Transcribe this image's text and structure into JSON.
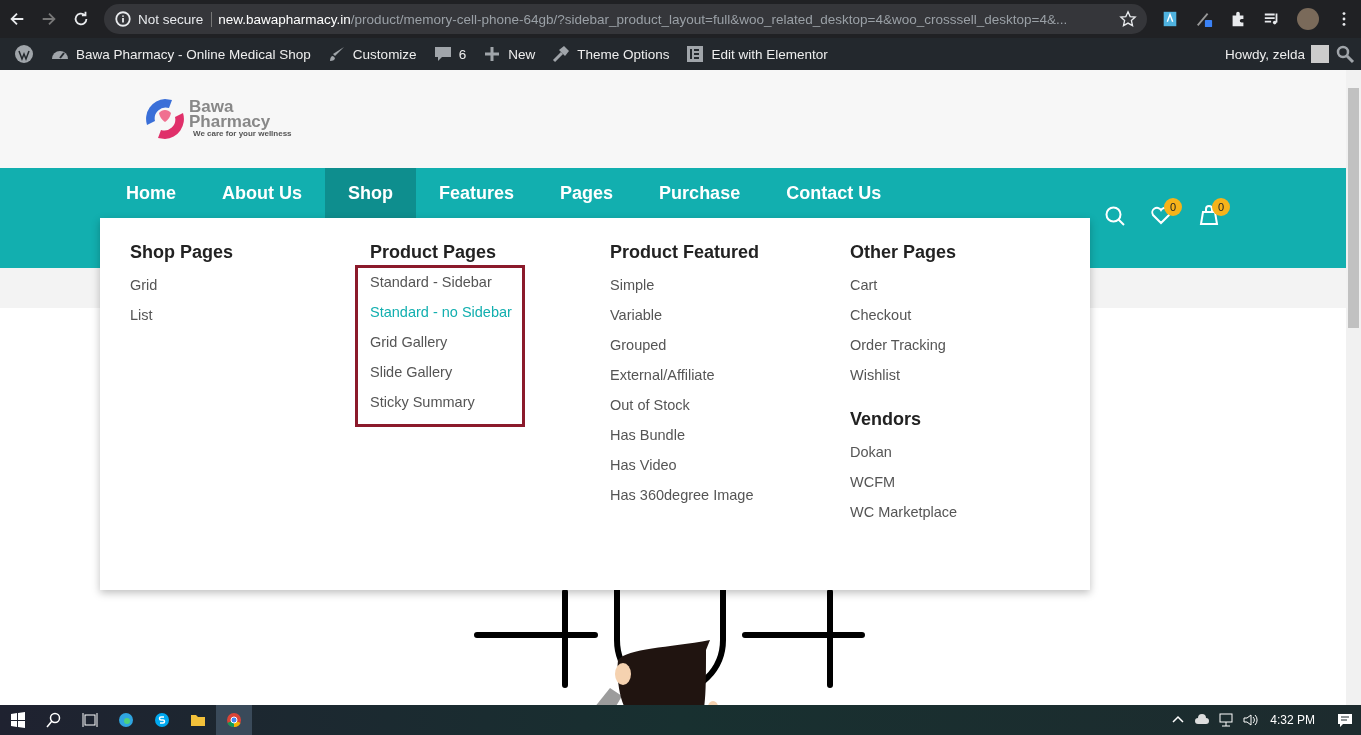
{
  "browser": {
    "security_label": "Not secure",
    "url_host": "new.bawapharmacy.in",
    "url_path": "/product/memory-cell-phone-64gb/?sidebar_product_layout=full&woo_related_desktop=4&woo_crosssell_desktop=4&..."
  },
  "admin_bar": {
    "items": [
      {
        "kind": "wordpress"
      },
      {
        "kind": "dashboard",
        "label": "Bawa Pharmacy - Online Medical Shop"
      },
      {
        "kind": "brush",
        "label": "Customize"
      },
      {
        "kind": "comment",
        "label": "6"
      },
      {
        "kind": "plus",
        "label": "New"
      },
      {
        "kind": "hammer",
        "label": "Theme Options"
      },
      {
        "kind": "elementor",
        "label": "Edit with Elementor"
      }
    ],
    "greeting": "Howdy, zelda"
  },
  "logo": {
    "line1": "Bawa",
    "line2": "Pharmacy",
    "tagline": "We care for your wellness"
  },
  "nav": [
    {
      "label": "Home",
      "selected": false
    },
    {
      "label": "About Us",
      "selected": false
    },
    {
      "label": "Shop",
      "selected": true
    },
    {
      "label": "Features",
      "selected": false
    },
    {
      "label": "Pages",
      "selected": false
    },
    {
      "label": "Purchase",
      "selected": false
    },
    {
      "label": "Contact Us",
      "selected": false
    }
  ],
  "header_actions": {
    "wishlist_count": "0",
    "cart_count": "0"
  },
  "mega_menu": [
    {
      "outlined": false,
      "sections": [
        {
          "heading": "Shop Pages",
          "items": [
            {
              "label": "Grid",
              "selected": false
            },
            {
              "label": "List",
              "selected": false
            }
          ]
        }
      ]
    },
    {
      "outlined": true,
      "sections": [
        {
          "heading": "Product Pages",
          "items": [
            {
              "label": "Standard - Sidebar",
              "selected": false
            },
            {
              "label": "Standard - no Sidebar",
              "selected": true
            },
            {
              "label": "Grid Gallery",
              "selected": false
            },
            {
              "label": "Slide Gallery",
              "selected": false
            },
            {
              "label": "Sticky Summary",
              "selected": false
            }
          ]
        }
      ]
    },
    {
      "outlined": false,
      "sections": [
        {
          "heading": "Product Featured",
          "items": [
            {
              "label": "Simple",
              "selected": false
            },
            {
              "label": "Variable",
              "selected": false
            },
            {
              "label": "Grouped",
              "selected": false
            },
            {
              "label": "External/Affiliate",
              "selected": false
            },
            {
              "label": "Out of Stock",
              "selected": false
            },
            {
              "label": "Has Bundle",
              "selected": false
            },
            {
              "label": "Has Video",
              "selected": false
            },
            {
              "label": "Has 360degree Image",
              "selected": false
            }
          ]
        }
      ]
    },
    {
      "outlined": false,
      "sections": [
        {
          "heading": "Other Pages",
          "items": [
            {
              "label": "Cart",
              "selected": false
            },
            {
              "label": "Checkout",
              "selected": false
            },
            {
              "label": "Order Tracking",
              "selected": false
            },
            {
              "label": "Wishlist",
              "selected": false
            }
          ]
        },
        {
          "heading": "Vendors",
          "items": [
            {
              "label": "Dokan",
              "selected": false
            },
            {
              "label": "WCFM",
              "selected": false
            },
            {
              "label": "WC Marketplace",
              "selected": false
            }
          ]
        }
      ]
    }
  ],
  "taskbar": {
    "time": "4:32 PM"
  }
}
